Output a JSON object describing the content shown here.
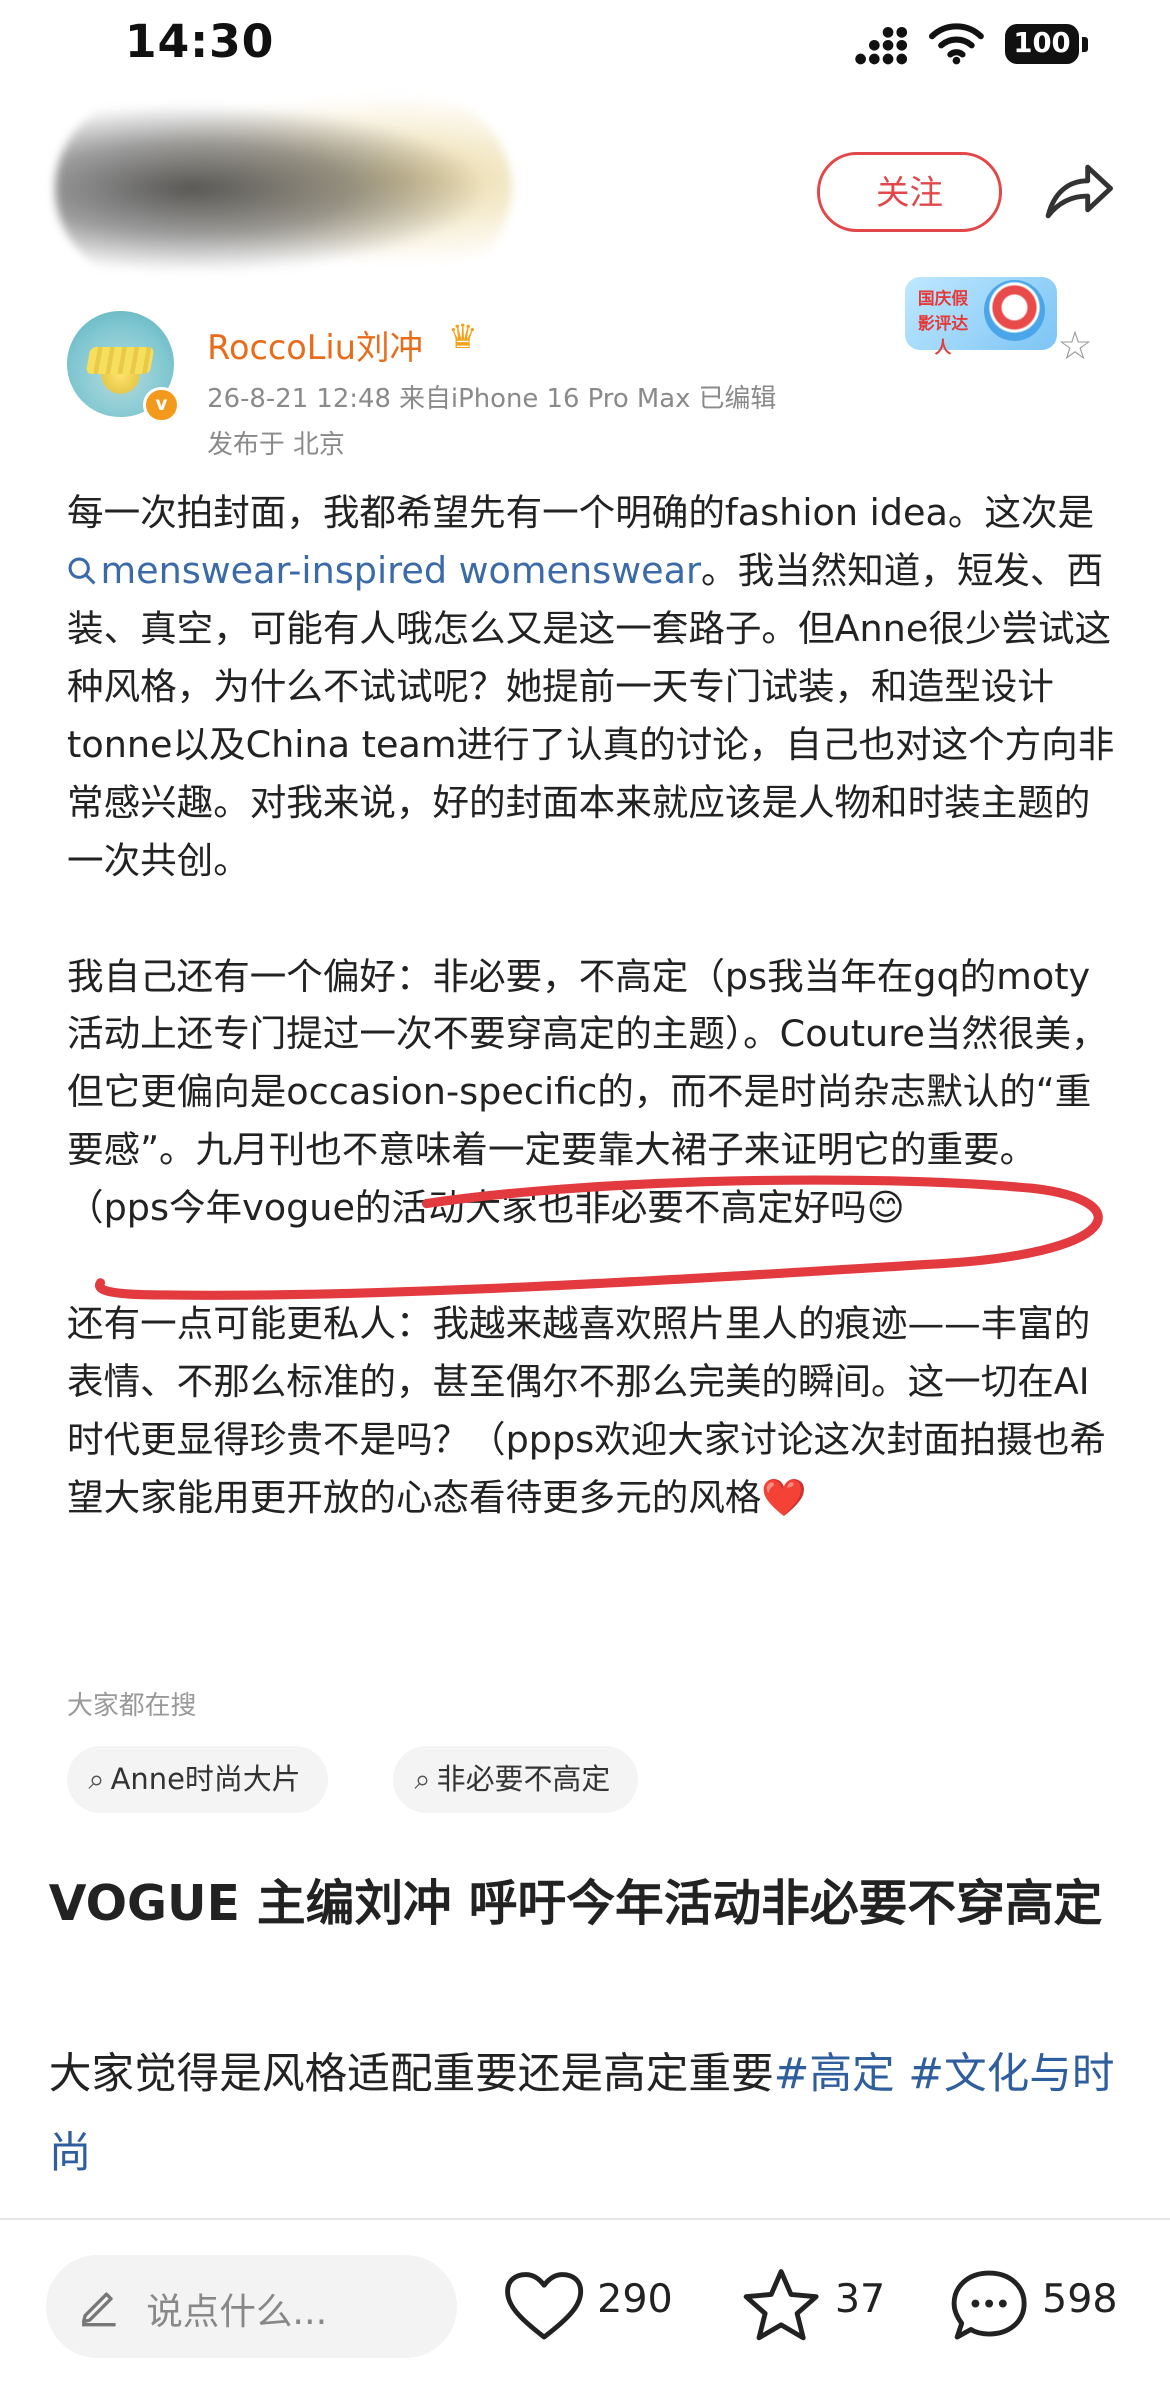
{
  "status_bar": {
    "time": "14:30",
    "battery": "100"
  },
  "header": {
    "follow_label": "关注"
  },
  "author": {
    "name": "RoccoLiu刘冲",
    "meta_line1": "26-8-21 12:48  来自iPhone 16 Pro Max  已编辑",
    "meta_line2": "发布于 北京"
  },
  "badge": {
    "text": "国庆假影评达人"
  },
  "post": {
    "p1_a": "每一次拍封面，我都希望先有一个明确的fashion idea。这次是 ",
    "p1_link": "menswear-inspired womenswear",
    "p1_b": "。我当然知道，短发、西装、真空，可能有人哦怎么又是这一套路子。但Anne很少尝试这种风格，为什么不试试呢？她提前一天专门试装，和造型设计tonne以及China team进行了认真的讨论，自己也对这个方向非常感兴趣。对我来说，好的封面本来就应该是人物和时装主题的一次共创。",
    "p2": "我自己还有一个偏好：非必要，不高定（ps我当年在gq的moty活动上还专门提过一次不要穿高定的主题）。Couture当然很美，但它更偏向是occasion-specific的，而不是时尚杂志默认的“重要感”。九月刊也不意味着一定要靠大裙子来证明它的重要。（pps今年vogue的活动大家也非必要不高定好吗",
    "p2_emoji": "😊",
    "p3": "还有一点可能更私人：我越来越喜欢照片里人的痕迹——丰富的表情、不那么标准的，甚至偶尔不那么完美的瞬间。这一切在AI时代更显得珍贵不是吗？（ppps欢迎大家讨论这次封面拍摄也希望大家能用更开放的心态看待更多元的风格",
    "p3_emoji": "❤️"
  },
  "search": {
    "label": "大家都在搜",
    "chips": [
      "Anne时尚大片",
      "非必要不高定"
    ]
  },
  "article": {
    "headline": "VOGUE 主编刘冲 呼吁今年活动非必要不穿高定",
    "desc": "大家觉得是风格适配重要还是高定重要",
    "tag1": "#高定",
    "tag2": "#文化与时尚"
  },
  "bottom_bar": {
    "comment_placeholder": "说点什么...",
    "likes": "290",
    "favorites": "37",
    "comments": "598"
  },
  "colors": {
    "accent_red": "#e2484a",
    "author_orange": "#e86c1a",
    "link_blue": "#3b6aa8",
    "annotation_red": "#e23a3f"
  },
  "icons": [
    "signal-icon",
    "wifi-icon",
    "battery-icon",
    "share-icon",
    "star-icon",
    "search-icon",
    "pencil-icon",
    "heart-icon",
    "comment-icon"
  ]
}
